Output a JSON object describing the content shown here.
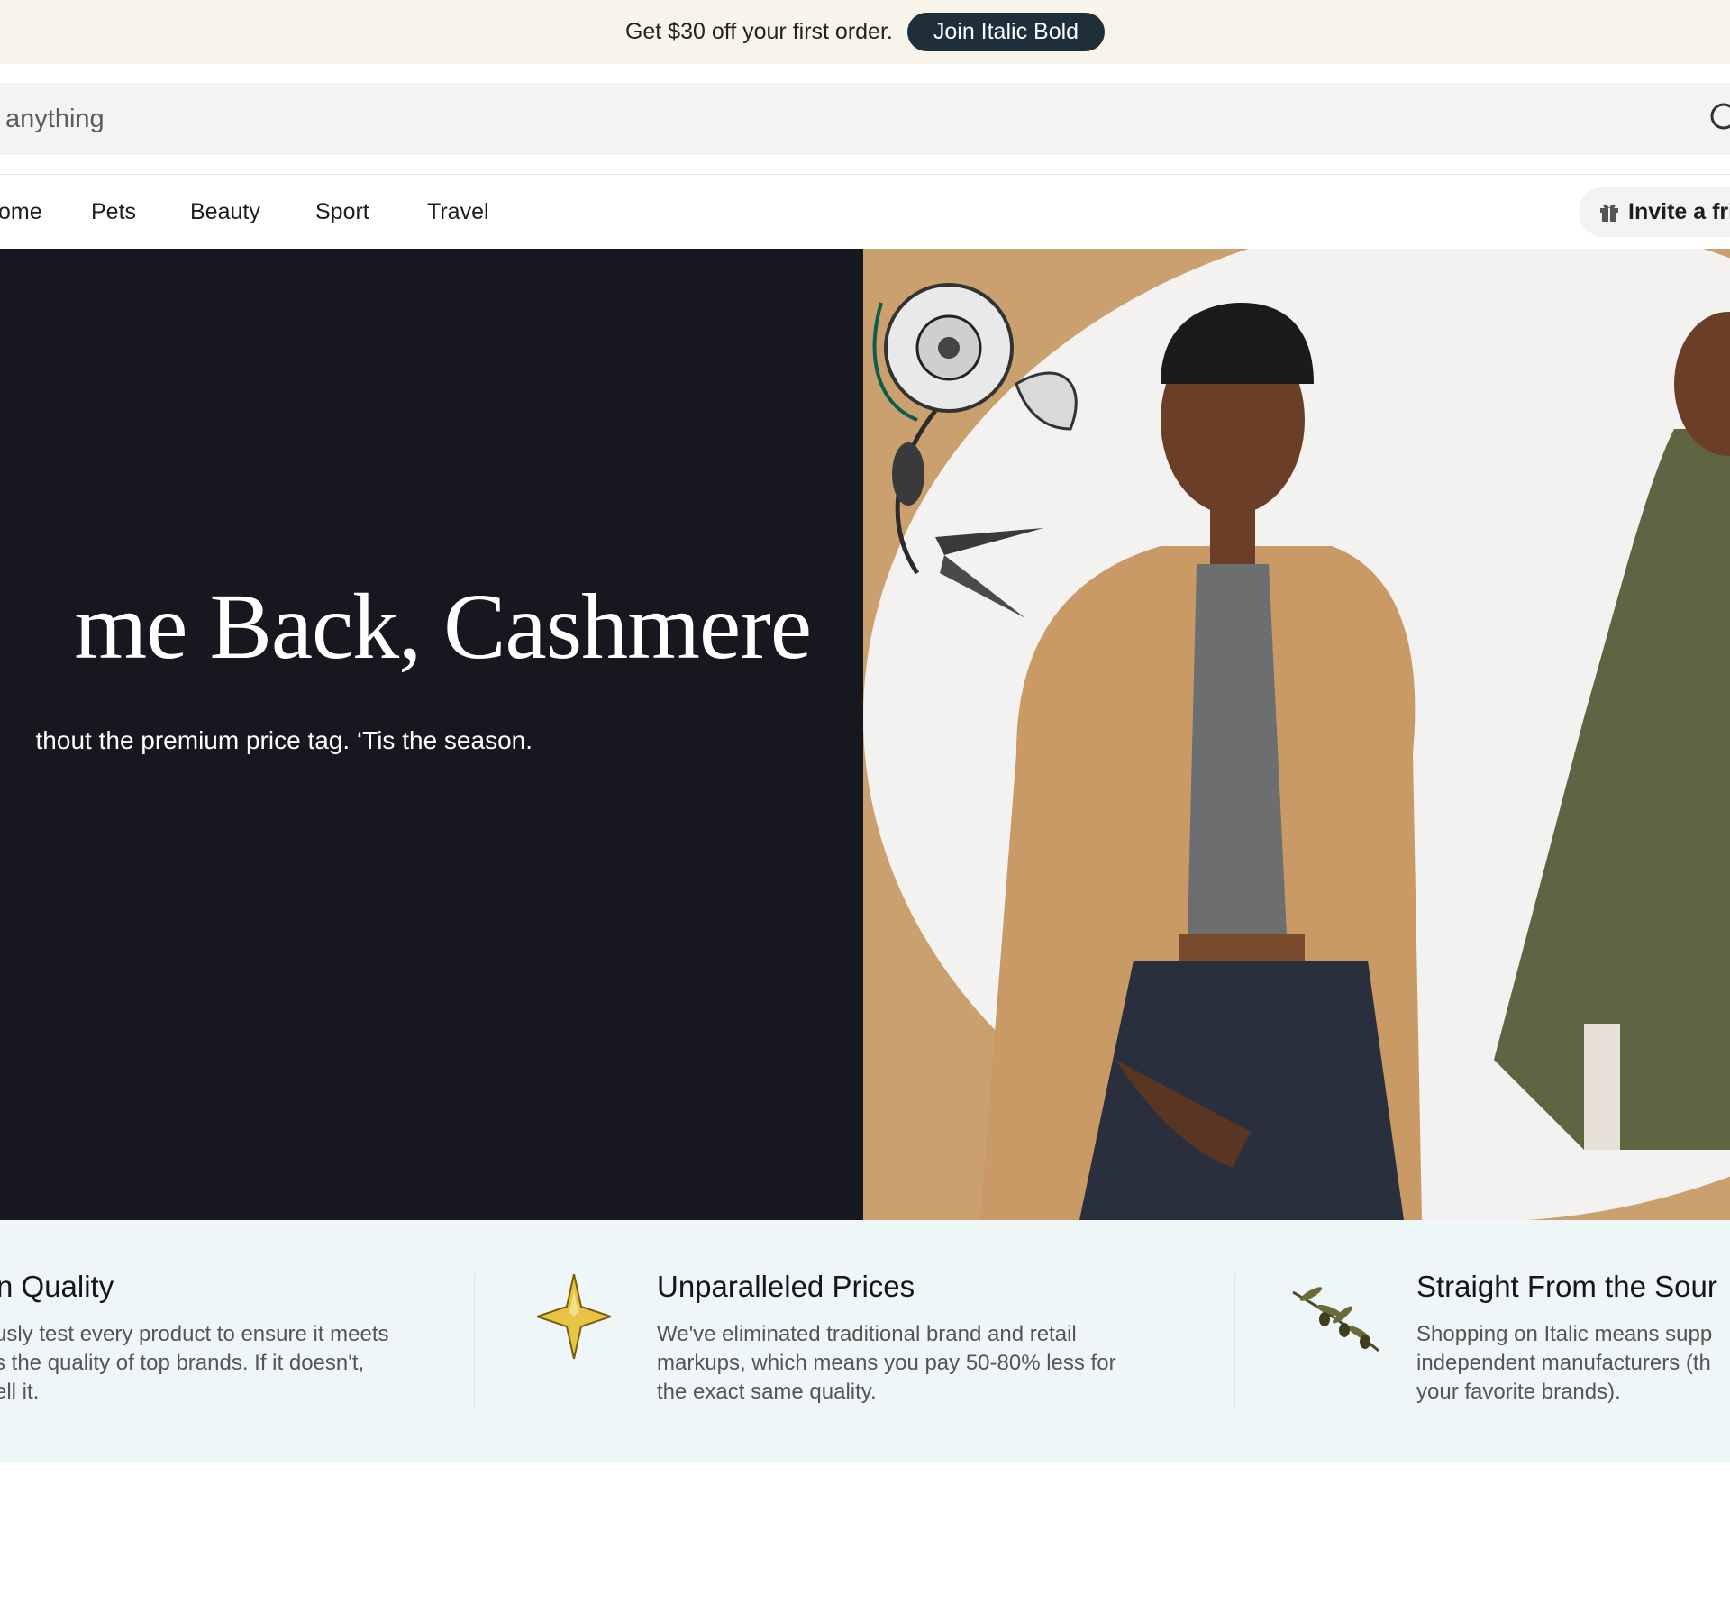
{
  "promo": {
    "text": "Get $30 off your first order.",
    "button_label": "Join Italic Bold",
    "button_color": "#1f2e38",
    "background": "#f8f4ea"
  },
  "search": {
    "placeholder": "anything",
    "icon": "search-icon"
  },
  "nav": {
    "items": [
      {
        "label": "ome"
      },
      {
        "label": "Pets"
      },
      {
        "label": "Beauty"
      },
      {
        "label": "Sport"
      },
      {
        "label": "Travel"
      }
    ],
    "invite_label": "Invite a fri",
    "invite_icon": "gift-icon"
  },
  "hero": {
    "title": "me Back, Cashmere",
    "subtitle": "thout the premium price tag. ‘Tis the season.",
    "left_background": "#171720",
    "accent_color": "#c9a06e"
  },
  "features": {
    "background": "#eff6f7",
    "items": [
      {
        "title": "n Quality",
        "body": "usly test every product to ensure it meets\ns the quality of top brands. If it doesn't,\nell it."
      },
      {
        "title": "Unparalleled Prices",
        "body": "We've eliminated traditional brand and retail\nmarkups, which means you pay 50-80% less for\nthe exact same quality.",
        "icon": "star-icon"
      },
      {
        "title": "Straight From the Sour",
        "body": "Shopping on Italic means supp\nindependent manufacturers (th\nyour favorite brands).",
        "icon": "olive-branch-icon"
      }
    ]
  }
}
